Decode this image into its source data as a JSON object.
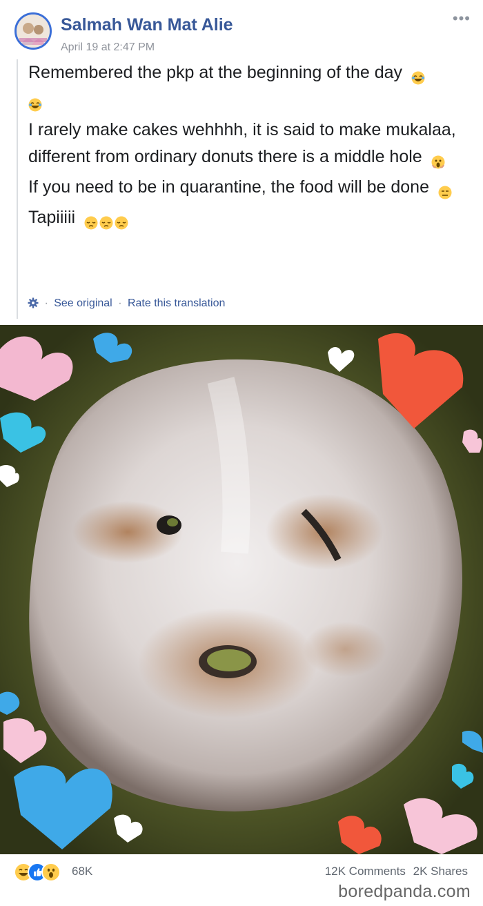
{
  "post": {
    "author": "Salmah Wan Mat Alie",
    "timestamp": "April 19 at 2:47 PM",
    "menu_icon": "more-horizontal-icon",
    "paragraphs": [
      "Remembered the pkp at the beginning of the day",
      "I rarely make cakes wehhhh, it is said to make mukalaa, different from ordinary donuts there is a middle hole",
      "If you need to be in quarantine, the food will be done",
      "Tapiiiii"
    ],
    "translation": {
      "see_original": "See original",
      "rate": "Rate this translation",
      "separator": "·"
    }
  },
  "photo": {
    "description_icon": "donut-photo"
  },
  "stats": {
    "reactions_count": "68K",
    "comments": "12K Comments",
    "shares": "2K Shares"
  },
  "watermark": "boredpanda.com",
  "colors": {
    "author": "#385898",
    "meta": "#90949c"
  }
}
